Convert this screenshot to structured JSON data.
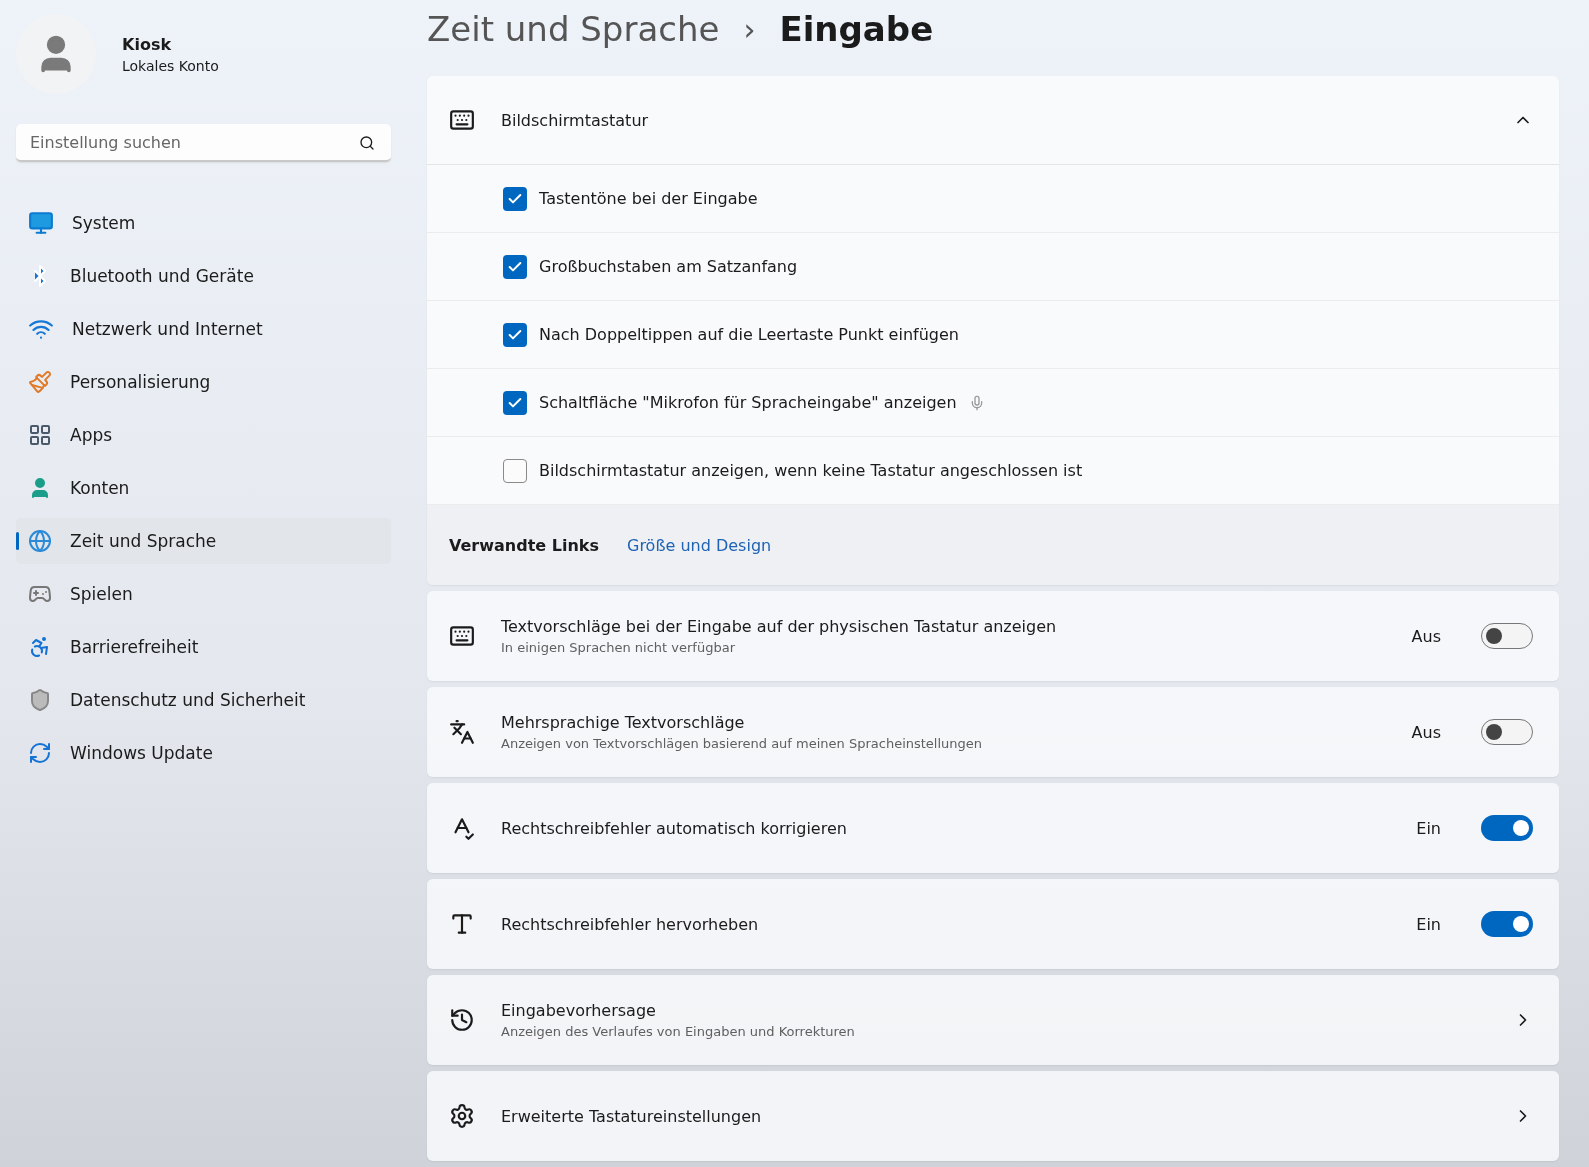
{
  "account": {
    "name": "Kiosk",
    "type": "Lokales Konto"
  },
  "search": {
    "placeholder": "Einstellung suchen"
  },
  "sidebar": {
    "items": [
      {
        "label": "System",
        "selected": false
      },
      {
        "label": "Bluetooth und Geräte",
        "selected": false
      },
      {
        "label": "Netzwerk und Internet",
        "selected": false
      },
      {
        "label": "Personalisierung",
        "selected": false
      },
      {
        "label": "Apps",
        "selected": false
      },
      {
        "label": "Konten",
        "selected": false
      },
      {
        "label": "Zeit und Sprache",
        "selected": true
      },
      {
        "label": "Spielen",
        "selected": false
      },
      {
        "label": "Barrierefreiheit",
        "selected": false
      },
      {
        "label": "Datenschutz und Sicherheit",
        "selected": false
      },
      {
        "label": "Windows Update",
        "selected": false
      }
    ]
  },
  "breadcrumb": {
    "parent": "Zeit und Sprache",
    "separator": "›",
    "current": "Eingabe"
  },
  "touch_keyboard": {
    "title": "Bildschirmtastatur",
    "expanded": true,
    "options": [
      {
        "label": "Tastentöne bei der Eingabe",
        "checked": true,
        "mic": false
      },
      {
        "label": "Großbuchstaben am Satzanfang",
        "checked": true,
        "mic": false
      },
      {
        "label": "Nach Doppeltippen auf die Leertaste Punkt einfügen",
        "checked": true,
        "mic": false
      },
      {
        "label": "Schaltfläche \"Mikrofon für Spracheingabe\" anzeigen",
        "checked": true,
        "mic": true
      },
      {
        "label": "Bildschirmtastatur anzeigen, wenn keine Tastatur angeschlossen ist",
        "checked": false,
        "mic": false
      }
    ],
    "related_links": {
      "label": "Verwandte Links",
      "links": [
        "Größe und Design"
      ]
    }
  },
  "settings": [
    {
      "kind": "toggle",
      "title": "Textvorschläge bei der Eingabe auf der physischen Tastatur anzeigen",
      "subtitle": "In einigen Sprachen nicht verfügbar",
      "state_label": "Aus",
      "on": false
    },
    {
      "kind": "toggle",
      "title": "Mehrsprachige Textvorschläge",
      "subtitle": "Anzeigen von Textvorschlägen basierend auf meinen Spracheinstellungen",
      "state_label": "Aus",
      "on": false
    },
    {
      "kind": "toggle",
      "title": "Rechtschreibfehler automatisch korrigieren",
      "state_label": "Ein",
      "on": true
    },
    {
      "kind": "toggle",
      "title": "Rechtschreibfehler hervorheben",
      "state_label": "Ein",
      "on": true
    },
    {
      "kind": "link",
      "title": "Eingabevorhersage",
      "subtitle": "Anzeigen des Verlaufes von Eingaben und Korrekturen"
    },
    {
      "kind": "link",
      "title": "Erweiterte Tastatureinstellungen"
    }
  ]
}
